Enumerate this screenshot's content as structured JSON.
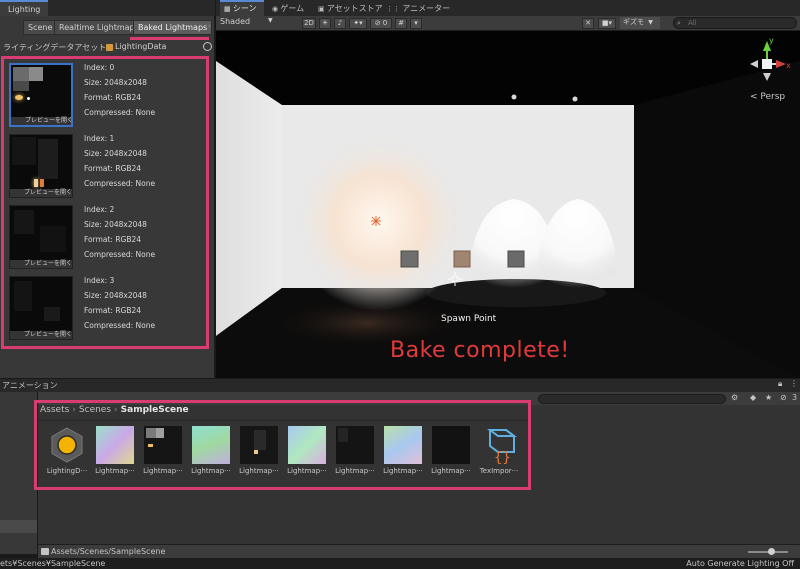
{
  "lighting_window": {
    "title": "Lighting",
    "tabs": [
      "Scene",
      "Realtime Lightmaps",
      "Baked Lightmaps"
    ],
    "active_tab": "Baked Lightmaps",
    "asset_label": "ライティングデータアセット",
    "asset_value": "LightingData",
    "preview_label": "プレビューを開く",
    "lightmaps": [
      {
        "index": "Index: 0",
        "size": "Size: 2048x2048",
        "format": "Format: RGB24",
        "compressed": "Compressed: None"
      },
      {
        "index": "Index: 1",
        "size": "Size: 2048x2048",
        "format": "Format: RGB24",
        "compressed": "Compressed: None"
      },
      {
        "index": "Index: 2",
        "size": "Size: 2048x2048",
        "format": "Format: RGB24",
        "compressed": "Compressed: None"
      },
      {
        "index": "Index: 3",
        "size": "Size: 2048x2048",
        "format": "Format: RGB24",
        "compressed": "Compressed: None"
      }
    ]
  },
  "scene_window": {
    "tabs": [
      "シーン",
      "ゲーム",
      "アセットストア",
      "アニメーター"
    ],
    "active_tab": "シーン",
    "shading_mode": "Shaded",
    "mode_2d": "2D",
    "gizmos": "ギズモ",
    "search_placeholder": "All",
    "persp_label": "< Persp",
    "axis_y": "y",
    "axis_x": "x",
    "spawn_label": "Spawn Point",
    "bake_message": "Bake complete!"
  },
  "bottom_panel": {
    "tab": "アニメーション",
    "breadcrumb": [
      "Assets",
      "Scenes",
      "SampleScene"
    ],
    "assets": [
      "LightingD···",
      "Lightmap···",
      "Lightmap···",
      "Lightmap···",
      "Lightmap···",
      "Lightmap···",
      "Lightmap···",
      "Lightmap···",
      "Lightmap···",
      "TexImpor···"
    ],
    "path": "Assets/Scenes/SampleScene",
    "badge_count": "3"
  },
  "status_bar": {
    "left": "ets¥Scenes¥SampleScene",
    "right": "Auto Generate Lighting Off"
  },
  "colors": {
    "highlight": "#d83c72",
    "bake_text": "#e23a3a",
    "active_tab_accent": "#5a8ad3"
  }
}
